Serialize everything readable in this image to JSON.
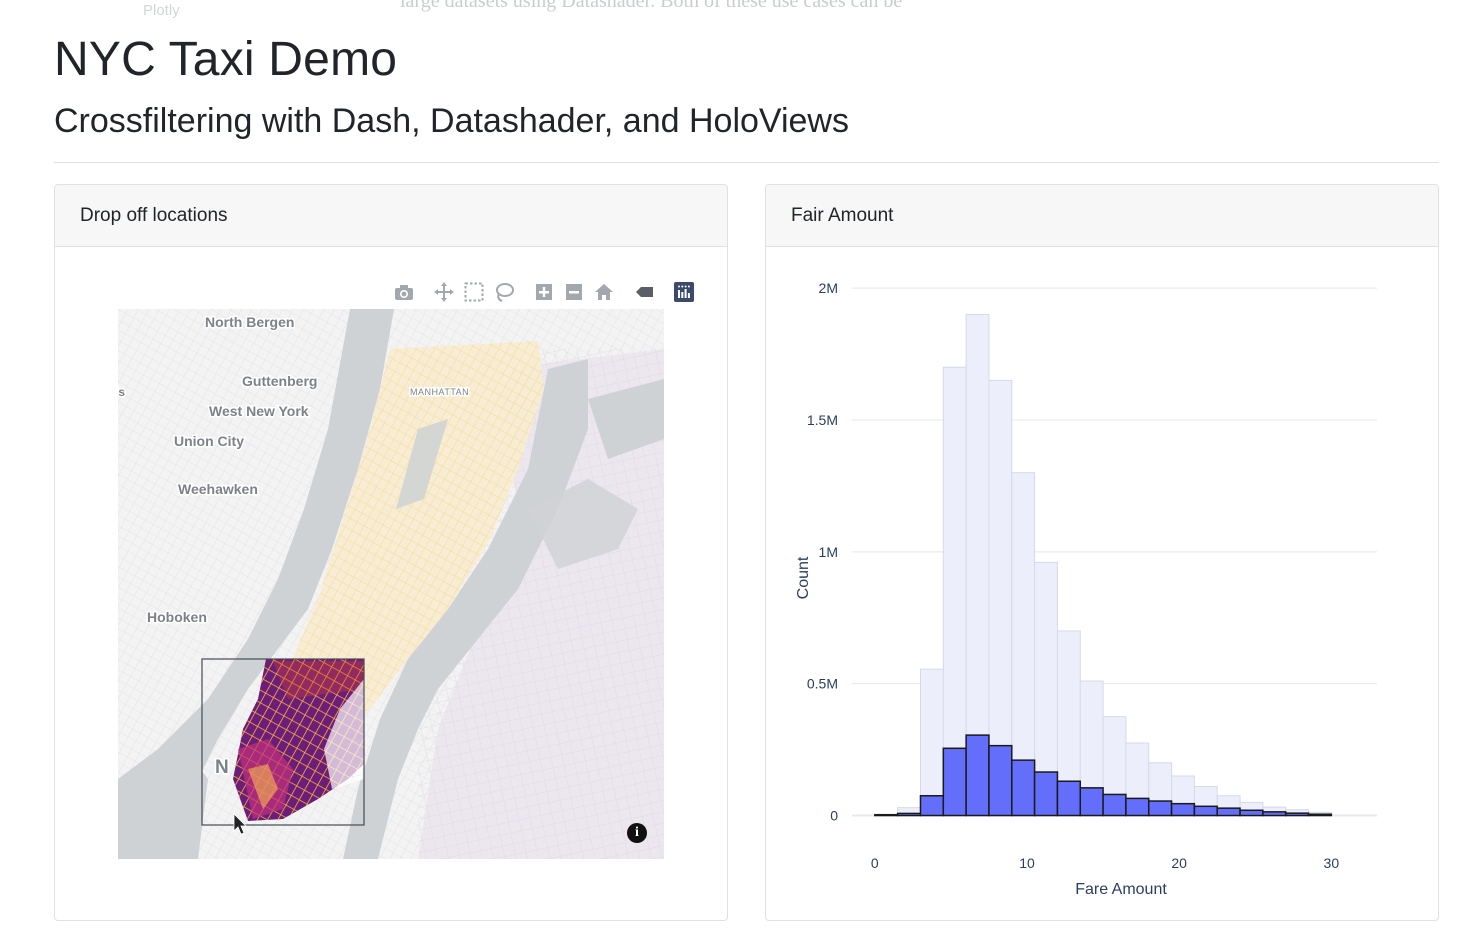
{
  "ghost": {
    "plotly_label": "Plotly",
    "intro_text": "large datasets using Datashader. Both of these use cases can be"
  },
  "page": {
    "title": "NYC Taxi Demo",
    "subtitle": "Crossfiltering with Dash, Datashader, and HoloViews"
  },
  "map_card": {
    "header": "Drop off locations",
    "modebar": [
      "camera-icon",
      "pan-icon",
      "box-select-icon",
      "lasso-select-icon",
      "zoom-in-icon",
      "zoom-out-icon",
      "home-icon",
      "hover-tag-icon",
      "plotly-logo-icon"
    ],
    "labels": {
      "north_bergen": "North Bergen",
      "guttenberg": "Guttenberg",
      "west_new_york": "West New York",
      "union_city": "Union City",
      "weehawken": "Weehawken",
      "hoboken": "Hoboken",
      "manhattan": "MANHATTAN",
      "edge_fragment": "ls",
      "nyc_fragment": "N"
    },
    "info_glyph": "i"
  },
  "hist_card": {
    "header": "Fair Amount"
  },
  "chart_data": {
    "type": "bar",
    "xlabel": "Fare Amount",
    "ylabel": "Count",
    "x_ticks": [
      "0",
      "10",
      "20",
      "30"
    ],
    "x_tick_values": [
      0,
      10,
      20,
      30
    ],
    "y_ticks": [
      "0",
      "0.5M",
      "1M",
      "1.5M",
      "2M"
    ],
    "y_tick_values": [
      0,
      500000,
      1000000,
      1500000,
      2000000
    ],
    "xlim": [
      -1.5,
      33
    ],
    "ylim": [
      -70000,
      2080000
    ],
    "bin_start": 0,
    "bin_width": 1.5,
    "grid": true,
    "series": [
      {
        "values": [
          5000,
          30000,
          555000,
          1700000,
          1900000,
          1650000,
          1300000,
          960000,
          700000,
          510000,
          375000,
          275000,
          200000,
          150000,
          110000,
          75000,
          50000,
          32000,
          22000,
          12000
        ],
        "color": "#eceefb",
        "stroke": "#d6d9e8"
      },
      {
        "values": [
          3000,
          8000,
          75000,
          255000,
          305000,
          265000,
          210000,
          165000,
          130000,
          105000,
          80000,
          65000,
          55000,
          45000,
          35000,
          28000,
          20000,
          14000,
          9000,
          5000
        ],
        "color": "#636efa",
        "stroke": "#1a1a1a"
      }
    ]
  },
  "colors": {
    "selected_bar": "#636efa",
    "unselected_bar": "#eceefb",
    "modebar_icon": "#a3a8ae",
    "modebar_active": "#3b4a6b"
  }
}
